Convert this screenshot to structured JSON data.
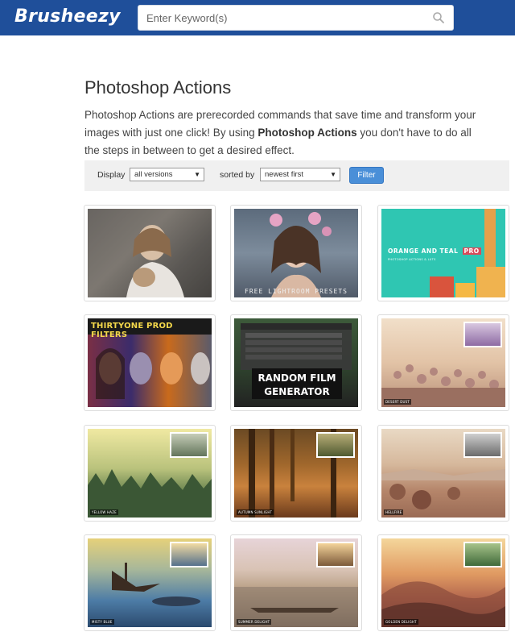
{
  "header": {
    "logo": "Brusheezy",
    "search_placeholder": "Enter Keyword(s)"
  },
  "page": {
    "title": "Photoshop Actions",
    "description_part1": "Photoshop Actions are prerecorded commands that save time and transform your images with just one click! By using ",
    "description_bold": "Photoshop Actions",
    "description_part2": " you don't have to do all the steps in between to get a desired effect."
  },
  "filters": {
    "display_label": "Display",
    "display_value": "all versions",
    "sorted_label": "sorted by",
    "sorted_value": "newest first",
    "filter_button": "Filter"
  },
  "items": [
    {
      "text": ""
    },
    {
      "text": "FREE LIGHTROOM PRESETS"
    },
    {
      "text": "ORANGE AND TEAL",
      "badge": "PRO",
      "subtext": "PHOTOSHOP ACTIONS & LUTS"
    },
    {
      "text": "THIRTYONE PROD FILTERS"
    },
    {
      "text": "RANDOM FILM GENERATOR"
    },
    {
      "text": "",
      "caption": "DESERT DUST"
    },
    {
      "text": "",
      "caption": "YELLOW HAZE"
    },
    {
      "text": "",
      "caption": "AUTUMN SUNLIGHT"
    },
    {
      "text": "",
      "caption": "HELLFIRE"
    },
    {
      "text": "",
      "caption": "MISTY BLUE"
    },
    {
      "text": "",
      "caption": "SUMMER DELIGHT"
    },
    {
      "text": "",
      "caption": "GOLDEN DELIGHT"
    }
  ]
}
